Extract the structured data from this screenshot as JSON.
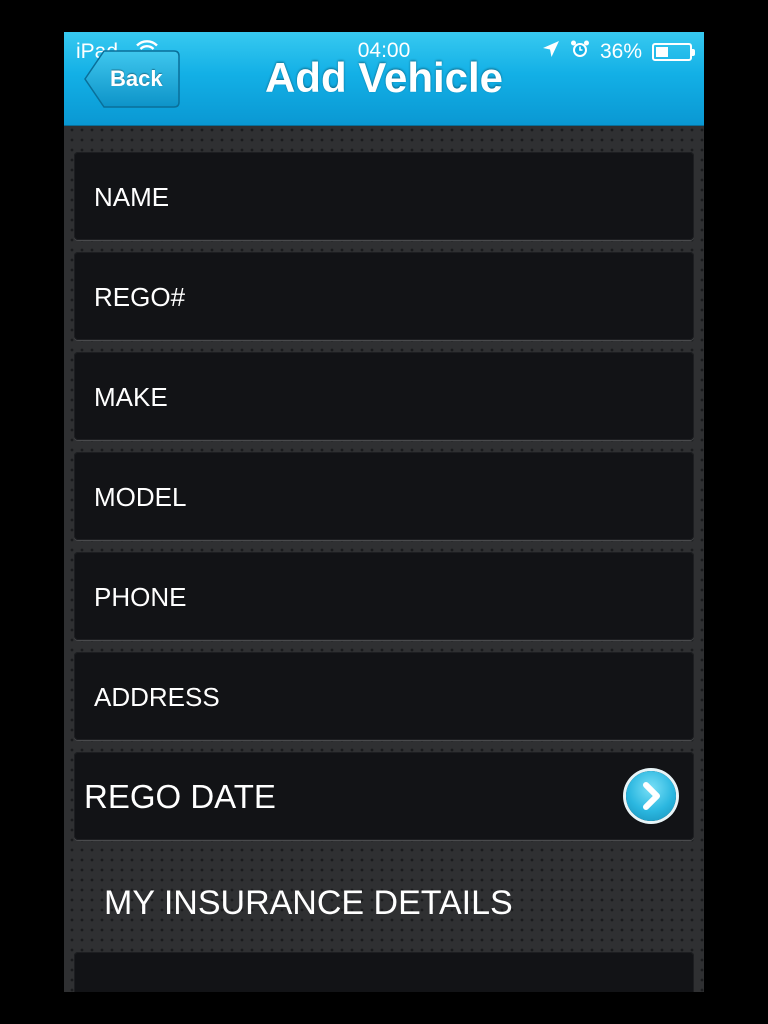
{
  "status_bar": {
    "carrier": "iPad",
    "time": "04:00",
    "battery": "36%",
    "battery_level": 0.36
  },
  "nav": {
    "back_label": "Back",
    "title": "Add Vehicle"
  },
  "fields": [
    {
      "label": "NAME"
    },
    {
      "label": "REGO#"
    },
    {
      "label": "MAKE"
    },
    {
      "label": "MODEL"
    },
    {
      "label": "PHONE"
    },
    {
      "label": "ADDRESS"
    }
  ],
  "rego_date": {
    "label": "REGO DATE",
    "icon": "chevron-right-icon"
  },
  "insurance": {
    "section_title": "MY INSURANCE DETAILS"
  },
  "colors": {
    "nav_accent": "#13b0e6",
    "field_bg": "#121316",
    "page_bg": "#2f3032"
  }
}
